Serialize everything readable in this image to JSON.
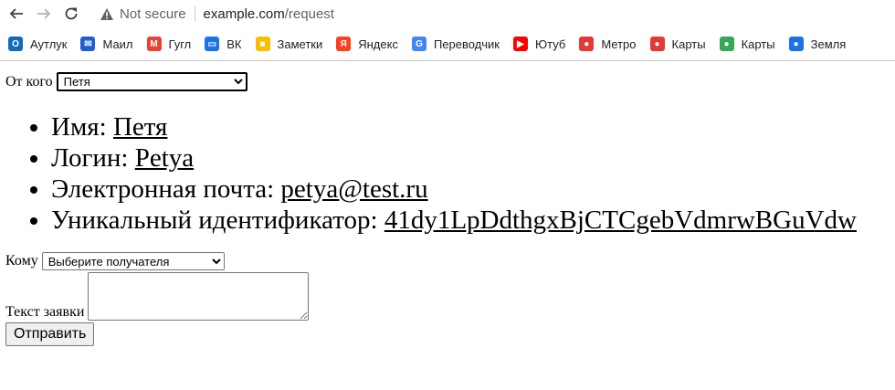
{
  "browser": {
    "security_label": "Not secure",
    "url_host": "example.com",
    "url_path": "/request"
  },
  "bookmarks": [
    {
      "label": "Аутлук",
      "icon": "outlook-icon",
      "color": "#0f6cbd",
      "glyph": "O"
    },
    {
      "label": "Маил",
      "icon": "mail-icon",
      "color": "#1f5fd1",
      "glyph": "✉"
    },
    {
      "label": "Гугл",
      "icon": "gmail-icon",
      "color": "#ea4335",
      "glyph": "M"
    },
    {
      "label": "ВК",
      "icon": "vk-icon",
      "color": "#1a73e8",
      "glyph": "▭"
    },
    {
      "label": "Заметки",
      "icon": "notes-icon",
      "color": "#fbbc04",
      "glyph": "■"
    },
    {
      "label": "Яндекс",
      "icon": "yandex-icon",
      "color": "#fc3f1d",
      "glyph": "Я"
    },
    {
      "label": "Переводчик",
      "icon": "translate-icon",
      "color": "#4285f4",
      "glyph": "G"
    },
    {
      "label": "Ютуб",
      "icon": "youtube-icon",
      "color": "#ff0000",
      "glyph": "▶"
    },
    {
      "label": "Метро",
      "icon": "metro-pin-icon",
      "color": "#e53935",
      "glyph": "●"
    },
    {
      "label": "Карты",
      "icon": "map-pin-icon",
      "color": "#e53935",
      "glyph": "●"
    },
    {
      "label": "Карты",
      "icon": "google-maps-icon",
      "color": "#34a853",
      "glyph": "●"
    },
    {
      "label": "Земля",
      "icon": "earth-icon",
      "color": "#1a73e8",
      "glyph": "●"
    }
  ],
  "form": {
    "from_label": "От кого",
    "from_selected": "Петя",
    "to_label": "Кому",
    "to_selected": "Выберите получателя",
    "text_label": "Текст заявки",
    "text_value": "",
    "submit_label": "Отправить"
  },
  "user": {
    "name_label": "Имя:",
    "name_value": "Петя",
    "login_label": "Логин:",
    "login_value": "Petya",
    "email_label": "Электронная почта:",
    "email_value": "petya@test.ru",
    "uid_label": "Уникальный идентификатор:",
    "uid_value": "41dy1LpDdthgxBjCTCgebVdmrwBGuVdw"
  }
}
